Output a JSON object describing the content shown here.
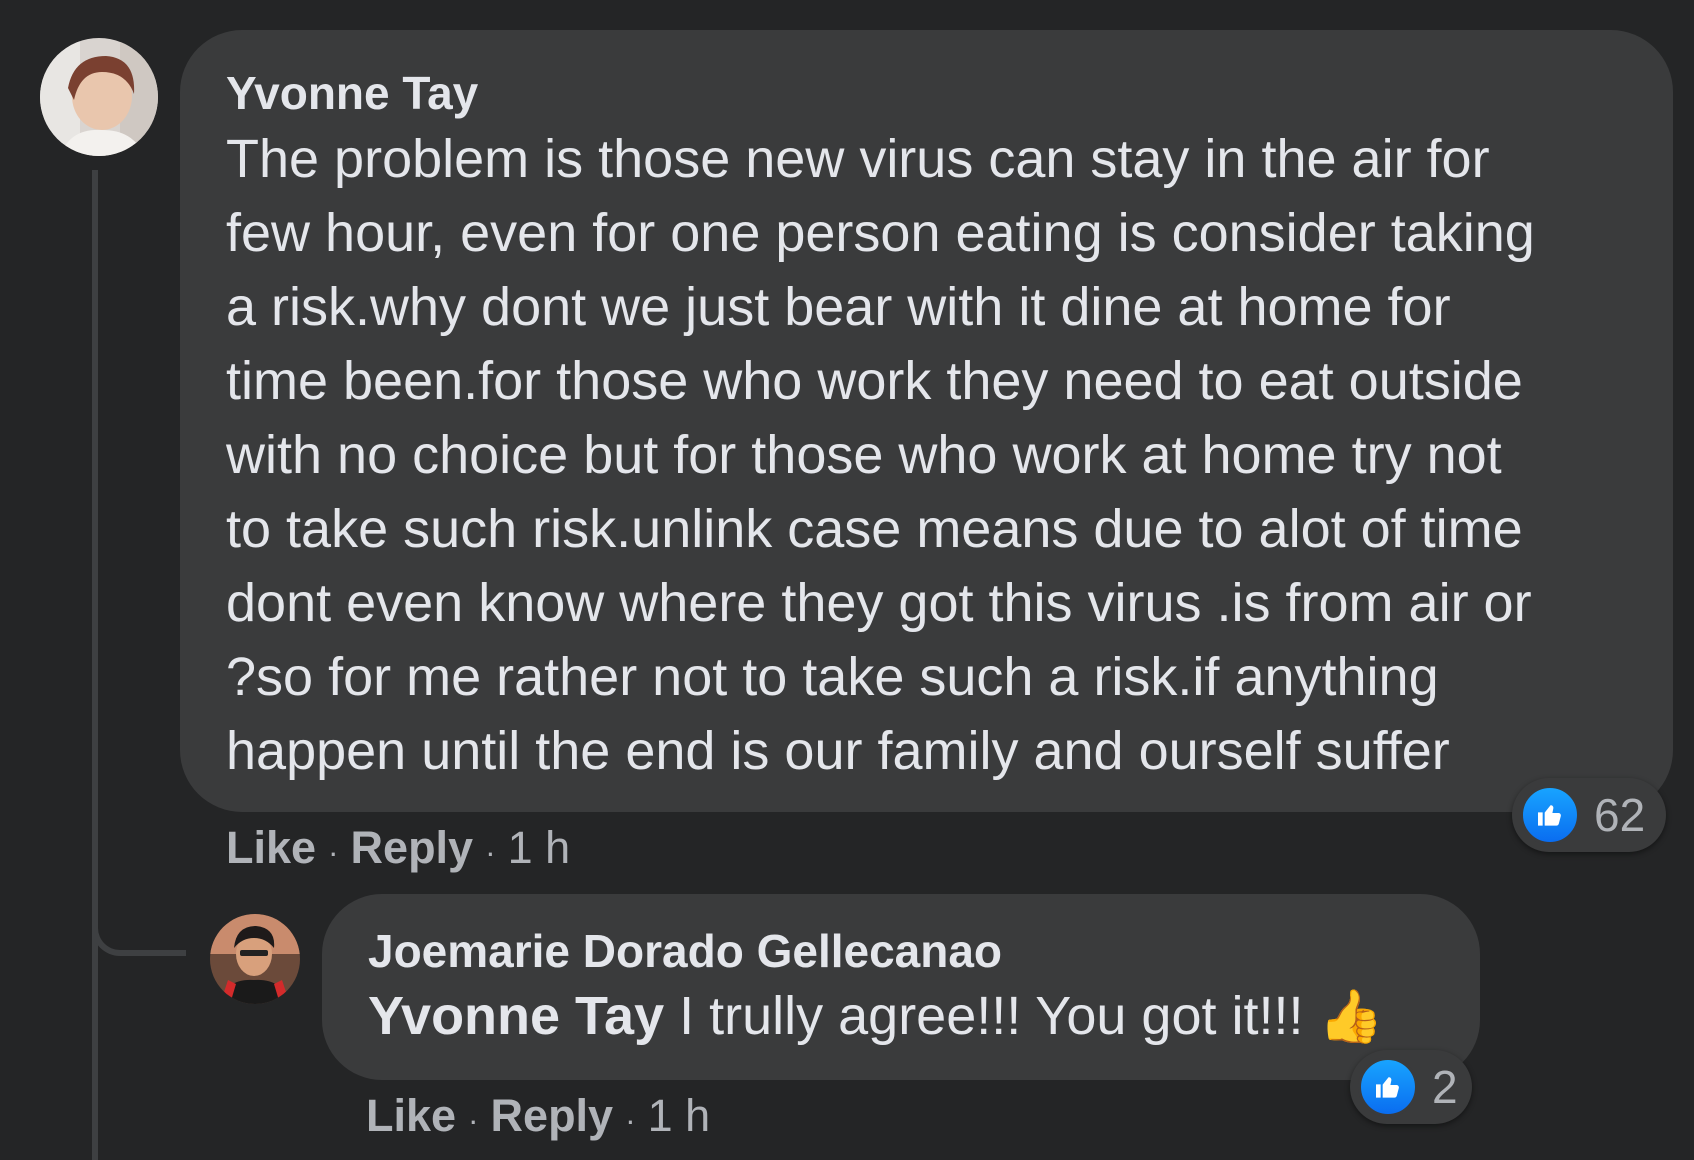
{
  "comment": {
    "author": "Yvonne Tay",
    "lines": [
      "The problem is those new virus can stay in the air for",
      "few hour, even for one person eating is consider taking",
      "a risk.why dont we just bear with it dine at home for",
      "time been.for those who work they need to eat outside",
      "with no choice but for those who work at home try not",
      "to take such risk.unlink case means due to alot of time",
      "dont even know where they got this virus .is from air or",
      "?so for me rather not to take such a risk.if anything",
      "happen until the end is our family and ourself suffer"
    ],
    "reaction_count": "62",
    "actions": {
      "like": "Like",
      "reply": "Reply",
      "time": "1 h",
      "sep": "·"
    }
  },
  "reply": {
    "author": "Joemarie Dorado Gellecanao",
    "mention": "Yvonne Tay",
    "text": " I trully agree!!! You got it!!! ",
    "emoji": "👍",
    "reaction_count": "2",
    "actions": {
      "like": "Like",
      "reply": "Reply",
      "time": "1 h",
      "sep": "·"
    }
  },
  "colors": {
    "background": "#242526",
    "bubble": "#3a3b3c",
    "text": "#e4e6eb",
    "secondary": "#b0b3b8",
    "like_blue": "#1877f2"
  },
  "icons": {
    "reaction": "thumbs-up-icon",
    "emoji": "thumbs-up-emoji"
  }
}
